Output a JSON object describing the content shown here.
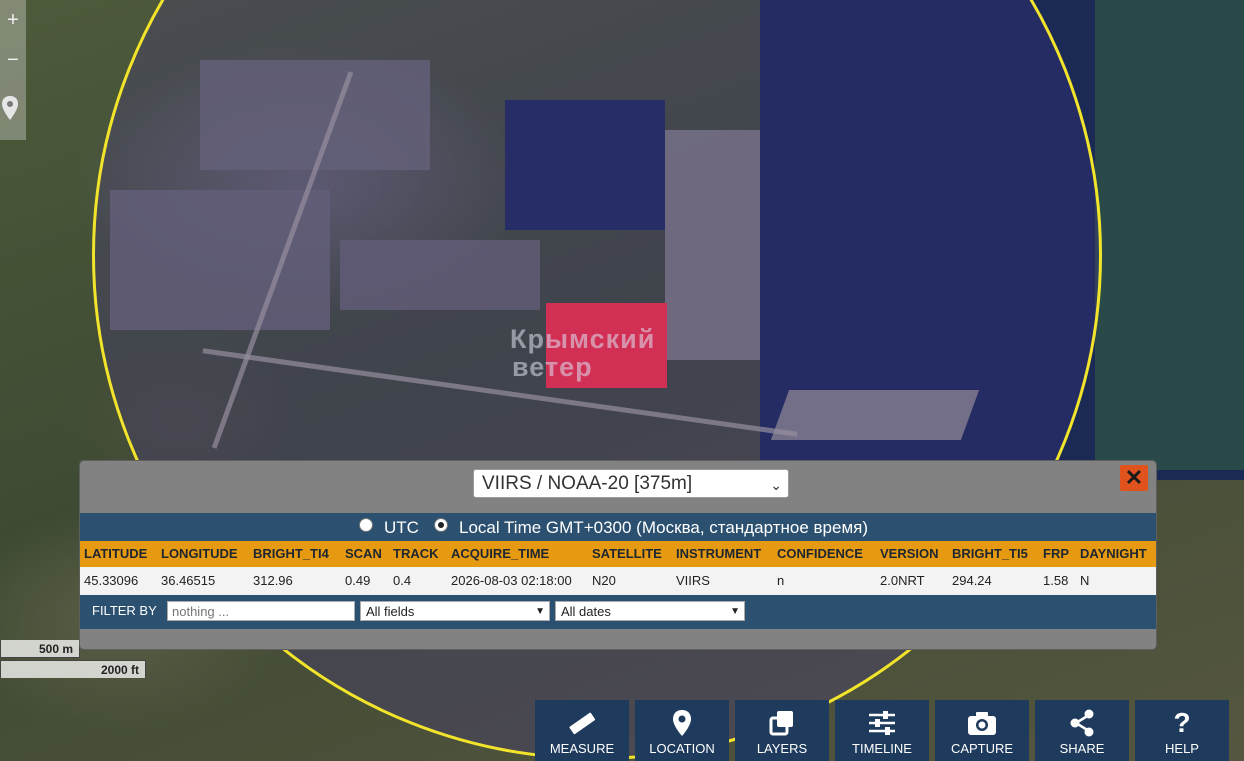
{
  "map": {
    "watermark_line1": "Крымский",
    "watermark_line2": "ветер",
    "zoom_in": "+",
    "zoom_out": "−",
    "scale_metric": "500 m",
    "scale_imperial": "2000 ft",
    "colors": {
      "circle": "#f2e42b",
      "hotspot": "#d22f55"
    }
  },
  "popup": {
    "satellite_selected": "VIIRS / NOAA-20 [375m]",
    "close_label": "✕",
    "tz_utc_label": "UTC",
    "tz_local_label": "Local Time GMT+0300 (Москва, стандартное время)",
    "tz_selected": "local",
    "columns": [
      "LATITUDE",
      "LONGITUDE",
      "BRIGHT_TI4",
      "SCAN",
      "TRACK",
      "ACQUIRE_TIME",
      "SATELLITE",
      "INSTRUMENT",
      "CONFIDENCE",
      "VERSION",
      "BRIGHT_TI5",
      "FRP",
      "DAYNIGHT"
    ],
    "rows": [
      [
        "45.33096",
        "36.46515",
        "312.96",
        "0.49",
        "0.4",
        "2026-08-03 02:18:00",
        "N20",
        "VIIRS",
        "n",
        "2.0NRT",
        "294.24",
        "1.58",
        "N"
      ]
    ],
    "filter_label": "FILTER BY",
    "filter_placeholder": "nothing ...",
    "filter_fields": "All fields",
    "filter_dates": "All dates",
    "colors": {
      "header": "#e59a12",
      "bar": "#2b5070",
      "close": "#e0531d"
    }
  },
  "toolbar": {
    "items": [
      {
        "label": "MEASURE",
        "icon": "ruler-icon"
      },
      {
        "label": "LOCATION",
        "icon": "pin-icon"
      },
      {
        "label": "LAYERS",
        "icon": "layers-icon"
      },
      {
        "label": "TIMELINE",
        "icon": "sliders-icon"
      },
      {
        "label": "CAPTURE",
        "icon": "camera-icon"
      },
      {
        "label": "SHARE",
        "icon": "share-icon"
      },
      {
        "label": "HELP",
        "icon": "help-icon"
      }
    ]
  }
}
